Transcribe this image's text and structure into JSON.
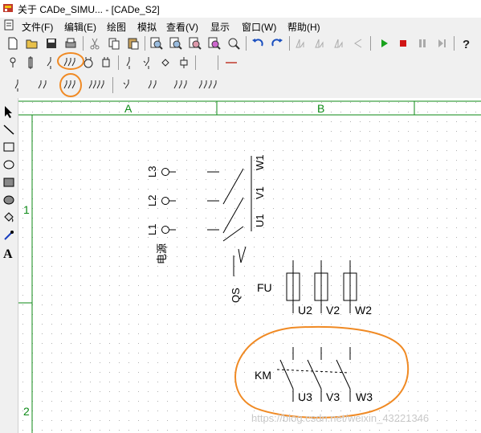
{
  "title": "关于 CADe_SIMU... - [CADe_S2]",
  "menu": [
    "文件(F)",
    "编辑(E)",
    "绘图",
    "模拟",
    "查看(V)",
    "显示",
    "窗口(W)",
    "帮助(H)"
  ],
  "toolbar_icons": {
    "row1": [
      "new-file-icon",
      "open-folder-icon",
      "save-icon",
      "print-icon",
      "cut-icon",
      "copy-icon",
      "paste-icon",
      "zoom-icon",
      "zoom-in-icon",
      "zoom-out-icon",
      "zoom-fit-icon",
      "undo-icon",
      "redo-icon",
      "align-icon",
      "play-icon",
      "stop-icon",
      "pause-icon",
      "step-icon",
      "help-icon"
    ],
    "row2": [
      "supply-terminal-icon",
      "fuse-icon",
      "single-switch-icon",
      "three-pole-switch-icon",
      "motor-icon",
      "coil-icon",
      "contact-icon",
      "n-contact-icon",
      "diamond-icon",
      "connector-icon",
      "line-icon"
    ],
    "row3": [
      "one-pole-icon",
      "two-pole-icon",
      "three-pole-icon",
      "four-pole-icon",
      "breaker-one-icon",
      "breaker-two-icon",
      "breaker-three-icon",
      "breaker-four-icon"
    ]
  },
  "left_tools": [
    "pointer-icon",
    "line-tool-icon",
    "rectangle-icon",
    "ellipse-icon",
    "filled-rect-icon",
    "filled-ellipse-icon",
    "fill-bucket-icon",
    "eyedropper-icon",
    "text-tool-icon"
  ],
  "columns": [
    "A",
    "B"
  ],
  "rows": [
    "1",
    "2"
  ],
  "schematic": {
    "terminals": [
      "L3",
      "L2",
      "L1"
    ],
    "supply_label": "电源",
    "switch_label": "QS",
    "switch_terminals": [
      "W1",
      "V1",
      "U1"
    ],
    "fuse_label": "FU",
    "fuse_terminals": [
      "U2",
      "V2",
      "W2"
    ],
    "contactor_label": "KM",
    "contactor_terminals": [
      "U3",
      "V3",
      "W3"
    ]
  },
  "watermark": "https://blog.csdn.net/weixin_43221346",
  "colors": {
    "highlight": "#f08a24",
    "grid_green": "#0c8a16",
    "toolbar_bg": "#f0f0f0"
  }
}
